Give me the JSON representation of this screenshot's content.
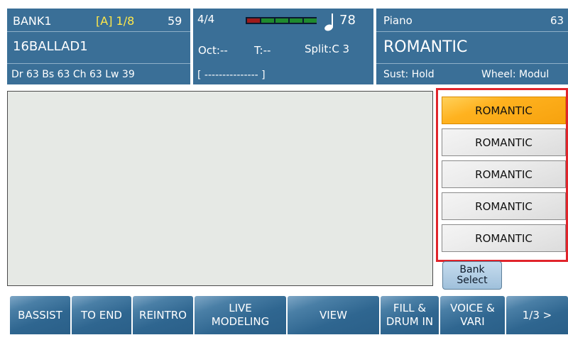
{
  "style_panel": {
    "bank": "BANK1",
    "variation": "[A] 1/8",
    "variation_color": "#ffe84a",
    "tempo_slot": "59",
    "style_name": "16BALLAD1",
    "mix": "Dr 63  Bs 63  Ch 63  Lw 39"
  },
  "mid_panel": {
    "time_signature": "4/4",
    "tempo": "78",
    "octave": "Oct:--",
    "transpose": "T:--",
    "split": "Split:C 3",
    "chord": "[ --------------- ]",
    "meter_colors": [
      "#9e1b1b",
      "#1f8a2e",
      "#1f8a2e",
      "#1f8a2e",
      "#1f8a2e"
    ]
  },
  "voice_panel": {
    "category": "Piano",
    "number": "63",
    "voice_name": "ROMANTIC",
    "sustain": "Sust: Hold",
    "wheel": "Wheel: Modul"
  },
  "voice_slots": [
    "ROMANTIC",
    "ROMANTIC",
    "ROMANTIC",
    "ROMANTIC",
    "ROMANTIC"
  ],
  "selected_slot_index": 0,
  "bank_select": {
    "line1": "Bank",
    "line2": "Select"
  },
  "softkeys": [
    {
      "line1": "BASSIST",
      "line2": ""
    },
    {
      "line1": "TO END",
      "line2": ""
    },
    {
      "line1": "REINTRO",
      "line2": ""
    },
    {
      "line1": "LIVE",
      "line2": "MODELING"
    },
    {
      "line1": "VIEW",
      "line2": ""
    },
    {
      "line1": "FILL &",
      "line2": "DRUM IN"
    },
    {
      "line1": "VOICE &",
      "line2": "VARI"
    },
    {
      "line1": "1/3 >",
      "line2": ""
    }
  ]
}
